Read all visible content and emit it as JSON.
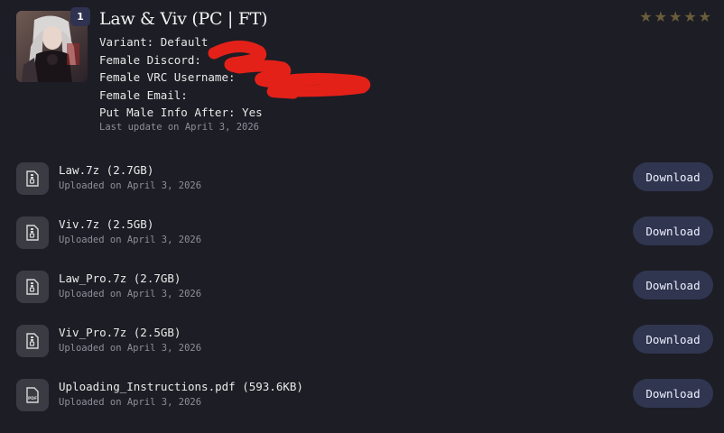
{
  "product": {
    "title": "Law & Viv (PC | FT)",
    "quantity_badge": "1",
    "rating_icon": "star-icon",
    "rating_color": "#6a5d3a",
    "meta_lines": [
      "Variant: Default",
      "Female Discord:",
      "Female VRC Username:",
      "Female Email:",
      "Put Male Info After: Yes"
    ],
    "last_update": "Last update on April 3, 2026",
    "redaction_color": "#e32119"
  },
  "files": [
    {
      "name": "Law.7z (2.7GB)",
      "uploaded": "Uploaded on April 3, 2026",
      "icon": "file-archive-icon",
      "action": "Download"
    },
    {
      "name": "Viv.7z (2.5GB)",
      "uploaded": "Uploaded on April 3, 2026",
      "icon": "file-archive-icon",
      "action": "Download"
    },
    {
      "name": "Law_Pro.7z (2.7GB)",
      "uploaded": "Uploaded on April 3, 2026",
      "icon": "file-archive-icon",
      "action": "Download"
    },
    {
      "name": "Viv_Pro.7z (2.5GB)",
      "uploaded": "Uploaded on April 3, 2026",
      "icon": "file-archive-icon",
      "action": "Download"
    },
    {
      "name": "Uploading_Instructions.pdf (593.6KB)",
      "uploaded": "Uploaded on April 3, 2026",
      "icon": "file-pdf-icon",
      "action": "Download"
    }
  ],
  "theme": {
    "background": "#1d1d25",
    "button": "#303650",
    "icon_tile": "#3b3b43"
  }
}
